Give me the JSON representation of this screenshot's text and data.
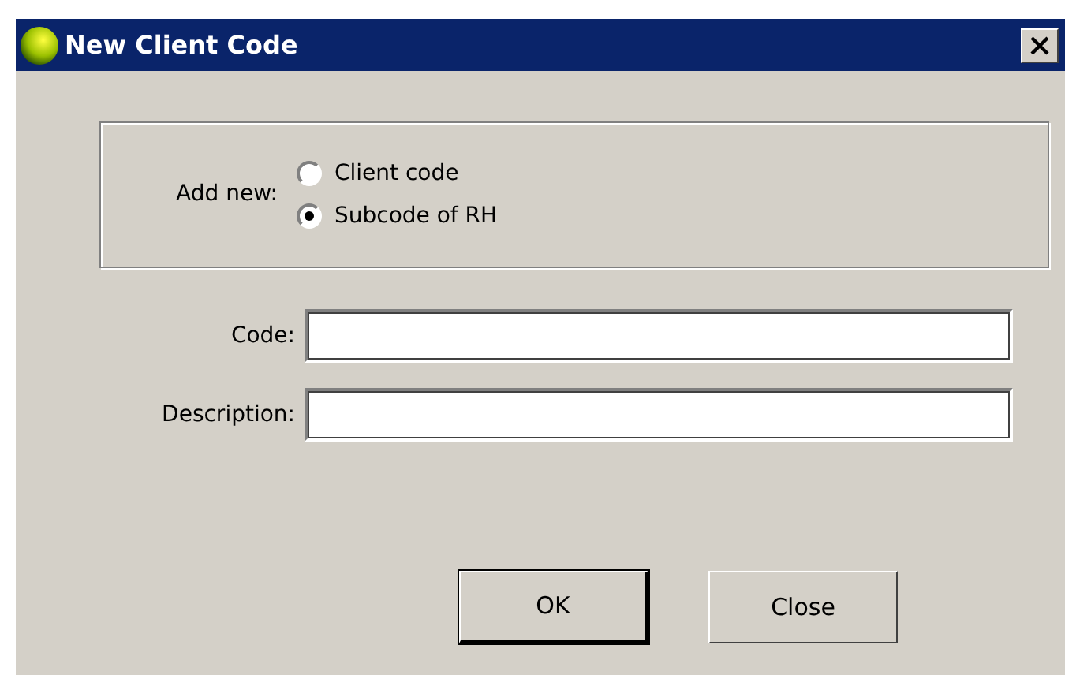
{
  "window": {
    "title": "New Client Code"
  },
  "add_new": {
    "label": "Add new:",
    "options": [
      {
        "label": "Client code",
        "selected": false
      },
      {
        "label": "Subcode of RH",
        "selected": true
      }
    ]
  },
  "fields": [
    {
      "label": "Code:"
    },
    {
      "label": "Description:"
    }
  ],
  "buttons": [
    {
      "label": "OK",
      "default": true
    },
    {
      "label": "Close",
      "default": false
    }
  ]
}
